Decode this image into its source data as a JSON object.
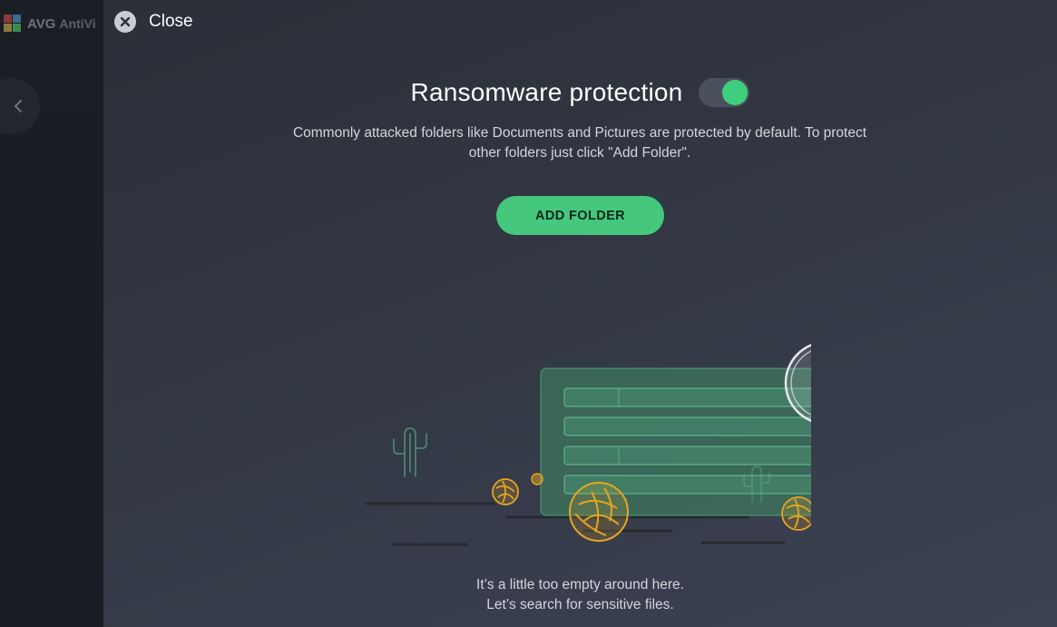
{
  "background_app": {
    "logo_text": "AVG",
    "app_name_partial": "AntiVi"
  },
  "dialog": {
    "close_label": "Close",
    "title": "Ransomware protection",
    "toggle_state": "on",
    "description_line1": "Commonly attacked folders like Documents and Pictures are protected by default. To protect",
    "description_line2": "other folders just click \"Add Folder\".",
    "add_folder_label": "ADD FOLDER",
    "empty_line1": "It’s a little too empty around here.",
    "empty_line2": "Let’s search for sensitive files."
  },
  "colors": {
    "accent_green": "#45c77d",
    "tumbleweed": "#e6a521",
    "panel_bg": "#323743"
  },
  "icons": {
    "close": "close-icon",
    "back": "chevron-left-icon",
    "illustration": "empty-folder-search-illustration"
  }
}
